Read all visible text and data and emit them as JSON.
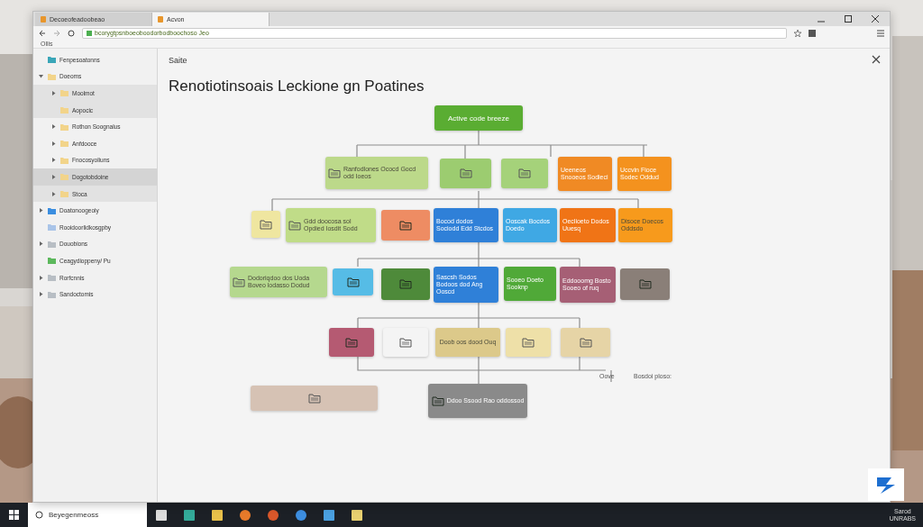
{
  "browser": {
    "tabs": [
      {
        "label": "Decoeofeadoobeao",
        "selected": false
      },
      {
        "label": "Acvon",
        "selected": true
      }
    ],
    "address": "bcorygtpsnboeoboodorbodboochoso Jeo",
    "bookmarks": [
      "Ollis"
    ]
  },
  "sidebar": {
    "items": [
      {
        "label": "Fenpesoatonns",
        "color": "#3aa6b8",
        "selected": false
      },
      {
        "label": "Doeoms",
        "color": "#f2d48a",
        "selected": false,
        "expanded": true,
        "children": [
          {
            "label": "Moolmot",
            "color": "#f2d48a",
            "selected": false,
            "expanded": false,
            "highlight": true
          },
          {
            "label": "Aopocic",
            "color": "#f2d48a",
            "selected": false,
            "highlight": true
          },
          {
            "label": "Rothon Soognalus",
            "color": "#f2d48a",
            "selected": false,
            "expanded": false,
            "highlight": false
          },
          {
            "label": "Anfdooce",
            "color": "#f2d48a",
            "selected": false,
            "expanded": false,
            "highlight": false
          },
          {
            "label": "Fnocosyoliuns",
            "color": "#f2d48a",
            "selected": false,
            "expanded": false,
            "highlight": false
          },
          {
            "label": "Dogotobdoine",
            "color": "#f2d48a",
            "selected": true,
            "expanded": false,
            "highlight": false
          },
          {
            "label": "Stoca",
            "color": "#f2d48a",
            "selected": false,
            "expanded": false,
            "highlight": true
          }
        ]
      },
      {
        "label": "Doatonoogeoiy",
        "color": "#3b8ee0",
        "selected": false,
        "expanded": false
      },
      {
        "label": "Rooidoorlidkosgpby",
        "color": "#a9c4e8",
        "selected": false
      },
      {
        "label": "Douobions",
        "color": "#b8bec4",
        "selected": false,
        "expanded": false
      },
      {
        "label": "Ceagydioppeny/ Pu",
        "color": "#5cb85c",
        "selected": false
      },
      {
        "label": "Rorfcnnis",
        "color": "#b8bec4",
        "selected": false,
        "expanded": false
      },
      {
        "label": "Sandoctomis",
        "color": "#b8bec4",
        "selected": false,
        "expanded": false
      }
    ]
  },
  "main": {
    "breadcrumb": "Saite",
    "title": "Renotiotinsoais Leckione gn Poatines",
    "diagram": {
      "root": {
        "text": "Active code breeze",
        "color": "#5aad32"
      },
      "nodes": [
        {
          "kind": "icon-text",
          "color": "#bcd98a",
          "text": "Ranfodlones Ococd Gocd odd Ioeos"
        },
        {
          "kind": "icon",
          "color": "#9ccc70"
        },
        {
          "kind": "icon",
          "color": "#a5d27a"
        },
        {
          "kind": "text",
          "color": "#f08a24",
          "text": "Ueeneos Snooeos Sodieci"
        },
        {
          "kind": "text",
          "color": "#f4921e",
          "text": "Uccvin Fioce Sodec Oddud"
        },
        {
          "kind": "icon",
          "color": "#efe6a0"
        },
        {
          "kind": "icon-text",
          "color": "#c0dc88",
          "text": "Gdd doocosa sol Opdied Iosdit Sodd"
        },
        {
          "kind": "icon",
          "color": "#ee8c63"
        },
        {
          "kind": "text",
          "color": "#2f80d8",
          "text": "Bocod dodos Sociodd Edd Stcdos"
        },
        {
          "kind": "text",
          "color": "#3fa8e4",
          "text": "Ooscak Bocdos Doedo"
        },
        {
          "kind": "text",
          "color": "#f07416",
          "text": "Oeclioeto Dodos Uuesq"
        },
        {
          "kind": "text",
          "color": "#f79a1c",
          "text": "Disoce Doecos Oddsdo"
        },
        {
          "kind": "icon-text",
          "color": "#b5d88e",
          "text": "Dodoriqdoo dos Uoda Boveo lodasso Dodud"
        },
        {
          "kind": "icon",
          "color": "#56bce6"
        },
        {
          "kind": "icon",
          "color": "#4e8a3a"
        },
        {
          "kind": "text",
          "color": "#2f80d8",
          "text": "Sascsh Sodos Bodoos dod Ang Ooscd"
        },
        {
          "kind": "text",
          "color": "#50a938",
          "text": "Sooeo Doeto Sooknp"
        },
        {
          "kind": "text",
          "color": "#a65f75",
          "text": "Eddooomg Bosto Sooeo of ruq"
        },
        {
          "kind": "icon",
          "color": "#8a7f78"
        },
        {
          "kind": "icon",
          "color": "#b55a72"
        },
        {
          "kind": "icon",
          "color": "#f4f4f4"
        },
        {
          "kind": "text",
          "color": "#dcc98a",
          "text": "Doob oos dood Ouq"
        },
        {
          "kind": "icon",
          "color": "#eee0a8"
        },
        {
          "kind": "icon",
          "color": "#e6d4a6"
        },
        {
          "kind": "icon",
          "color": "#d6c2b4"
        },
        {
          "kind": "icon-text",
          "color": "#8a8a8a",
          "text": "Ddoo Ssood Rao oddossod"
        }
      ],
      "labels": [
        "Oove",
        "Bosdoi ploso:"
      ]
    }
  },
  "taskbar": {
    "search": "Beyegenmeoss",
    "clock": [
      "Sarod",
      "UNRABS"
    ]
  }
}
